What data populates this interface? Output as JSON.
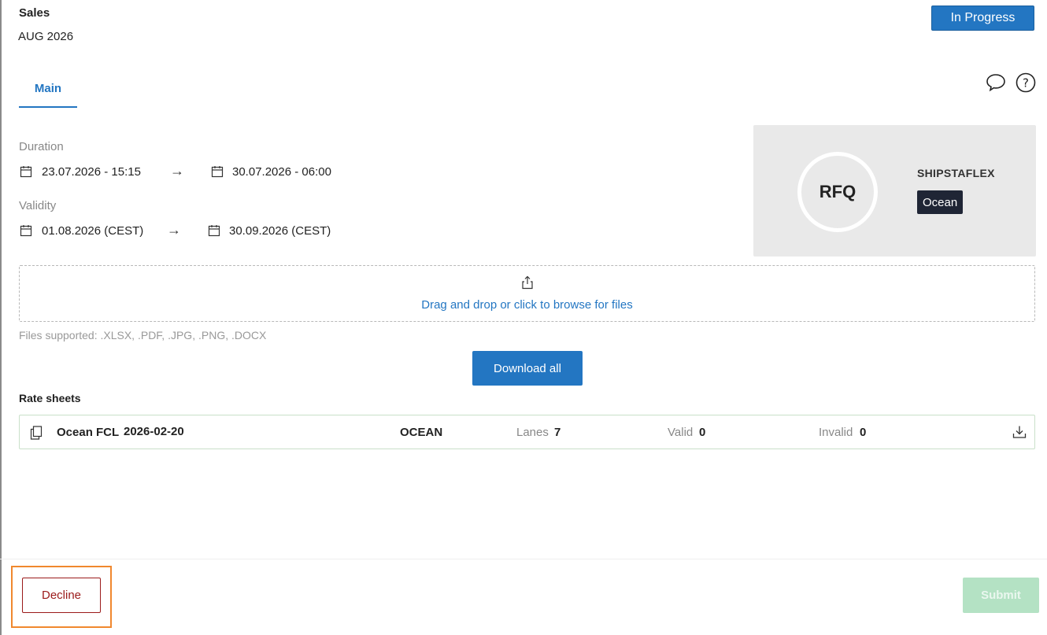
{
  "header": {
    "title": "Sales",
    "period": "AUG 2026",
    "status": "In Progress"
  },
  "tabs": [
    {
      "label": "Main",
      "active": true
    }
  ],
  "toolbar_icons": [
    "chat-icon",
    "help-icon"
  ],
  "duration": {
    "label": "Duration",
    "start": "23.07.2026 - 15:15",
    "end": "30.07.2026 - 06:00"
  },
  "validity": {
    "label": "Validity",
    "start": "01.08.2026 (CEST)",
    "end": "30.09.2026 (CEST)"
  },
  "arrow": "→",
  "rfq_card": {
    "badge": "RFQ",
    "carrier": "SHIPSTAFLEX",
    "mode": "Ocean"
  },
  "upload": {
    "prompt": "Drag and drop or click to browse for files",
    "supported": "Files supported: .XLSX, .PDF, .JPG, .PNG, .DOCX"
  },
  "download_all_label": "Download all",
  "rate_sheets": {
    "title": "Rate sheets",
    "rows": [
      {
        "name": "Ocean FCL",
        "date": "2026-02-20",
        "mode": "OCEAN",
        "lanes_label": "Lanes",
        "lanes": "7",
        "valid_label": "Valid",
        "valid": "0",
        "invalid_label": "Invalid",
        "invalid": "0"
      }
    ]
  },
  "footer": {
    "decline_label": "Decline",
    "submit_label": "Submit"
  },
  "colors": {
    "primary": "#2376c2",
    "decline": "#9b1a1a",
    "submit_disabled": "#b4e2c4",
    "highlight": "#f0882e",
    "tag_dark": "#1f2535"
  }
}
